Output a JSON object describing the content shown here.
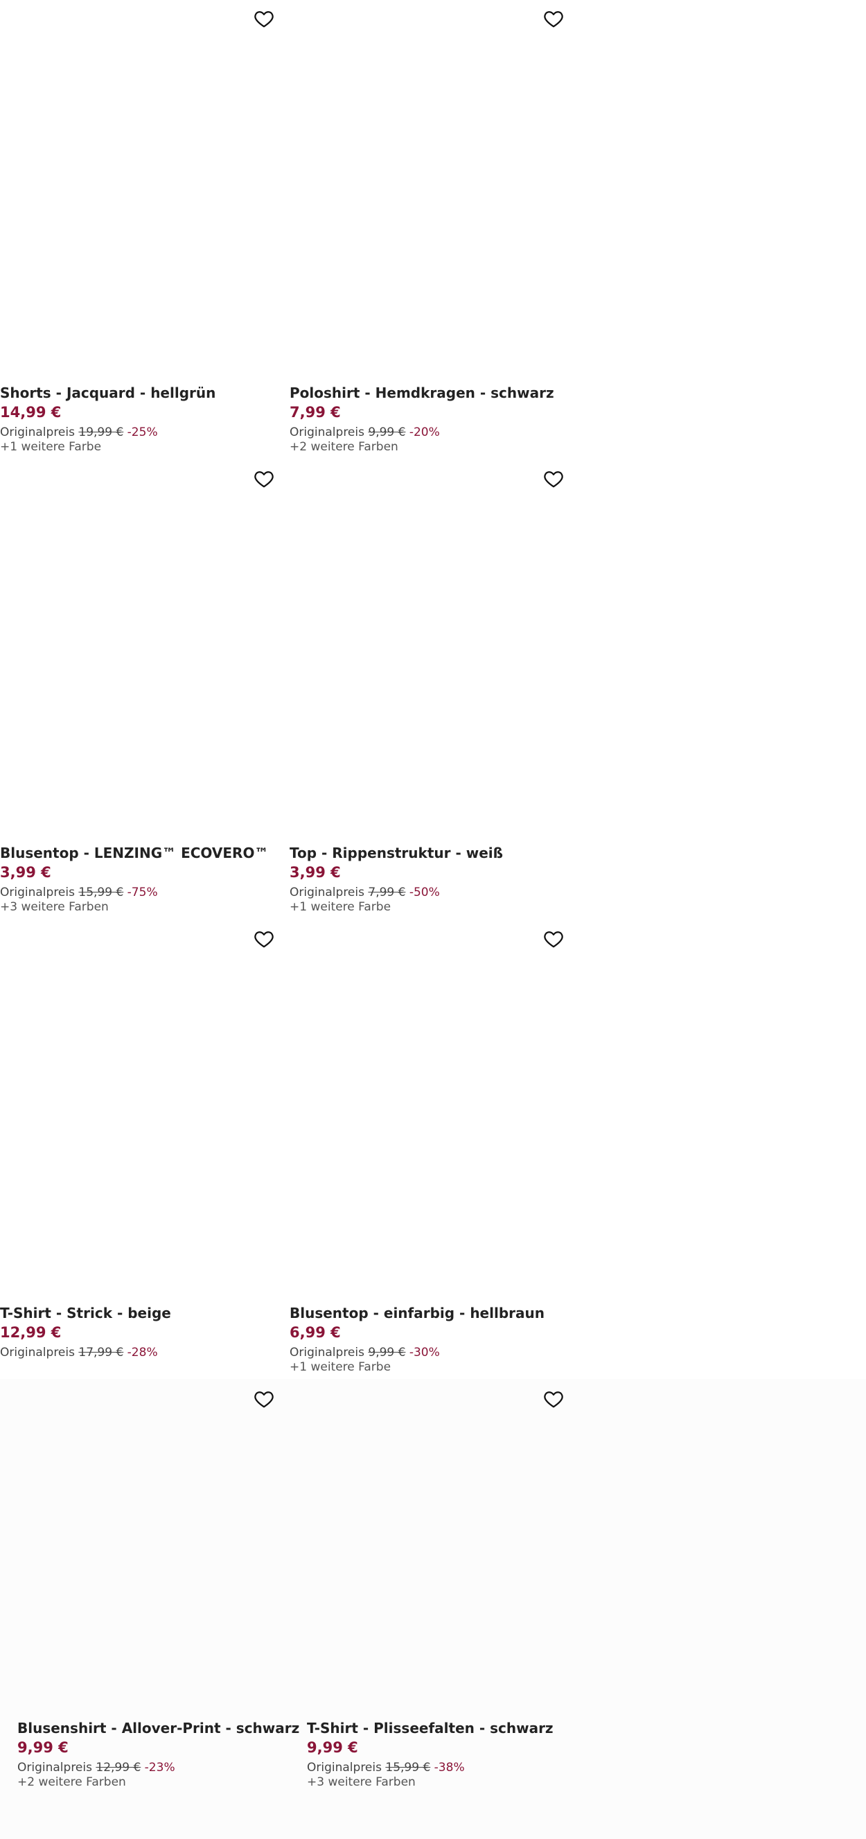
{
  "products": [
    {
      "title": "Shorts - Jacquard - hellgrün",
      "price": "14,99 €",
      "orig_label": "Originalpreis",
      "orig_price": "19,99 €",
      "discount": "-25%",
      "colors": "+1 weitere Farbe"
    },
    {
      "title": "Poloshirt - Hemdkragen - schwarz",
      "price": "7,99 €",
      "orig_label": "Originalpreis",
      "orig_price": "9,99 €",
      "discount": "-20%",
      "colors": "+2 weitere Farben"
    },
    {
      "title": "Blusentop - LENZING™ ECOVERO™",
      "price": "3,99 €",
      "orig_label": "Originalpreis",
      "orig_price": "15,99 €",
      "discount": "-75%",
      "colors": "+3 weitere Farben"
    },
    {
      "title": "Top - Rippenstruktur - weiß",
      "price": "3,99 €",
      "orig_label": "Originalpreis",
      "orig_price": "7,99 €",
      "discount": "-50%",
      "colors": "+1 weitere Farbe"
    },
    {
      "title": "T-Shirt - Strick - beige",
      "price": "12,99 €",
      "orig_label": "Originalpreis",
      "orig_price": "17,99 €",
      "discount": "-28%",
      "colors": ""
    },
    {
      "title": "Blusentop - einfarbig - hellbraun",
      "price": "6,99 €",
      "orig_label": "Originalpreis",
      "orig_price": "9,99 €",
      "discount": "-30%",
      "colors": "+1 weitere Farbe"
    },
    {
      "title": "Blusenshirt - Allover-Print - schwarz",
      "price": "9,99 €",
      "orig_label": "Originalpreis",
      "orig_price": "12,99 €",
      "discount": "-23%",
      "colors": "+2 weitere Farben"
    },
    {
      "title": "T-Shirt - Plisseefalten - schwarz",
      "price": "9,99 €",
      "orig_label": "Originalpreis",
      "orig_price": "15,99 €",
      "discount": "-38%",
      "colors": "+3 weitere Farben"
    }
  ],
  "colors": {
    "price_accent": "#8a1538",
    "title_text": "#222222",
    "meta_text": "#444444"
  },
  "icons": {
    "favorite": "heart-outline-icon"
  }
}
